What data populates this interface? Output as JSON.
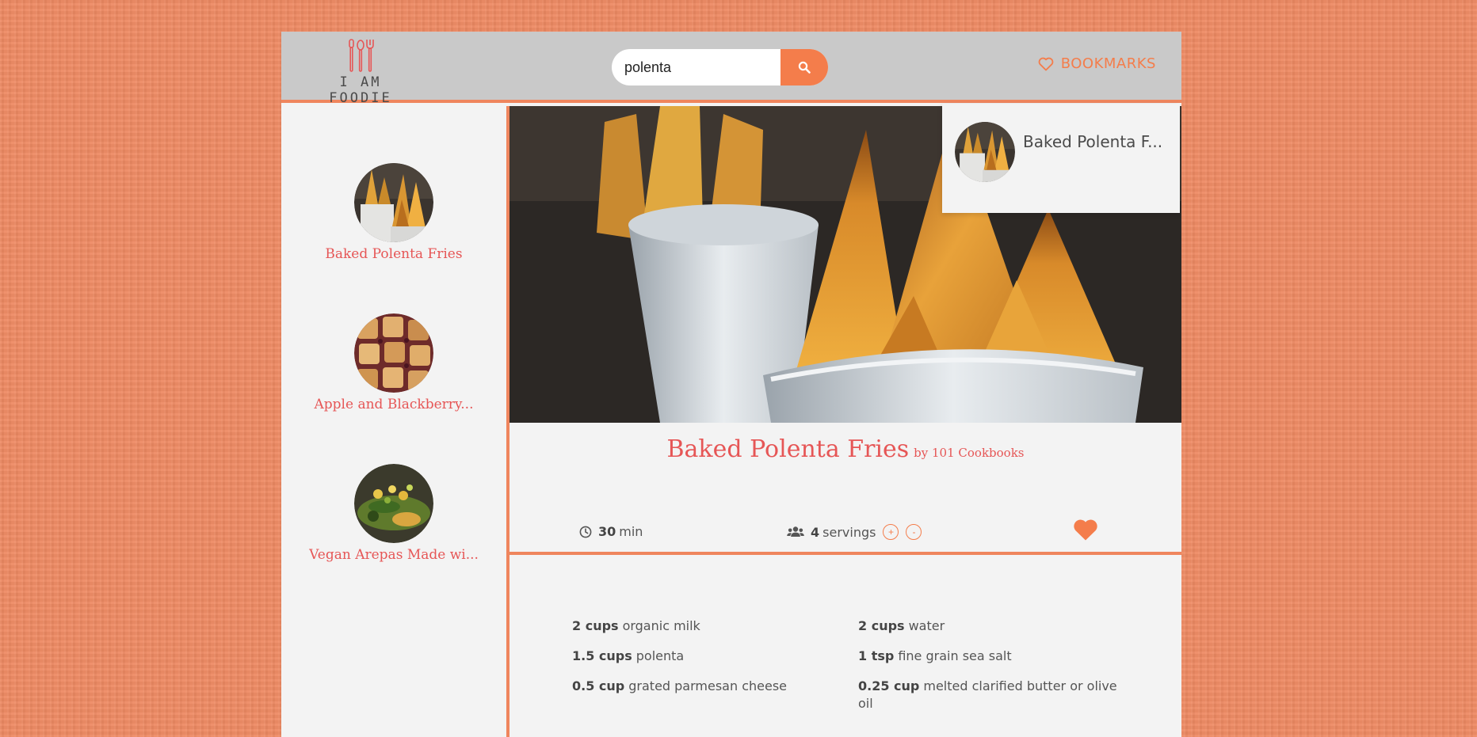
{
  "brand": {
    "logo_text": "I AM FOODIE"
  },
  "search": {
    "value": "polenta",
    "button_icon": "search-icon"
  },
  "header": {
    "bookmarks_label": "BOOKMARKS"
  },
  "results": [
    {
      "title": "Baked Polenta Fries"
    },
    {
      "title": "Apple and Blackberry..."
    },
    {
      "title": "Vegan Arepas Made wi..."
    }
  ],
  "bookmarks_panel": {
    "items": [
      {
        "title": "Baked Polenta F..."
      }
    ]
  },
  "recipe": {
    "title": "Baked Polenta Fries",
    "by": "by 101 Cookbooks",
    "time_value": "30",
    "time_unit": "min",
    "servings_value": "4",
    "servings_unit": "servings",
    "increase_label": "+",
    "decrease_label": "-",
    "ingredients": [
      {
        "qty": "2 cups",
        "name": "organic milk"
      },
      {
        "qty": "2 cups",
        "name": "water"
      },
      {
        "qty": "1.5 cups",
        "name": "polenta"
      },
      {
        "qty": "1 tsp",
        "name": "fine grain sea salt"
      },
      {
        "qty": "0.5 cup",
        "name": "grated parmesan cheese"
      },
      {
        "qty": "0.25 cup",
        "name": "melted clarified butter or olive oil"
      }
    ]
  },
  "colors": {
    "accent": "#f47d4b",
    "title_red": "#e65656",
    "header_bg": "#c9c9c9",
    "page_bg": "#ee8a63"
  }
}
